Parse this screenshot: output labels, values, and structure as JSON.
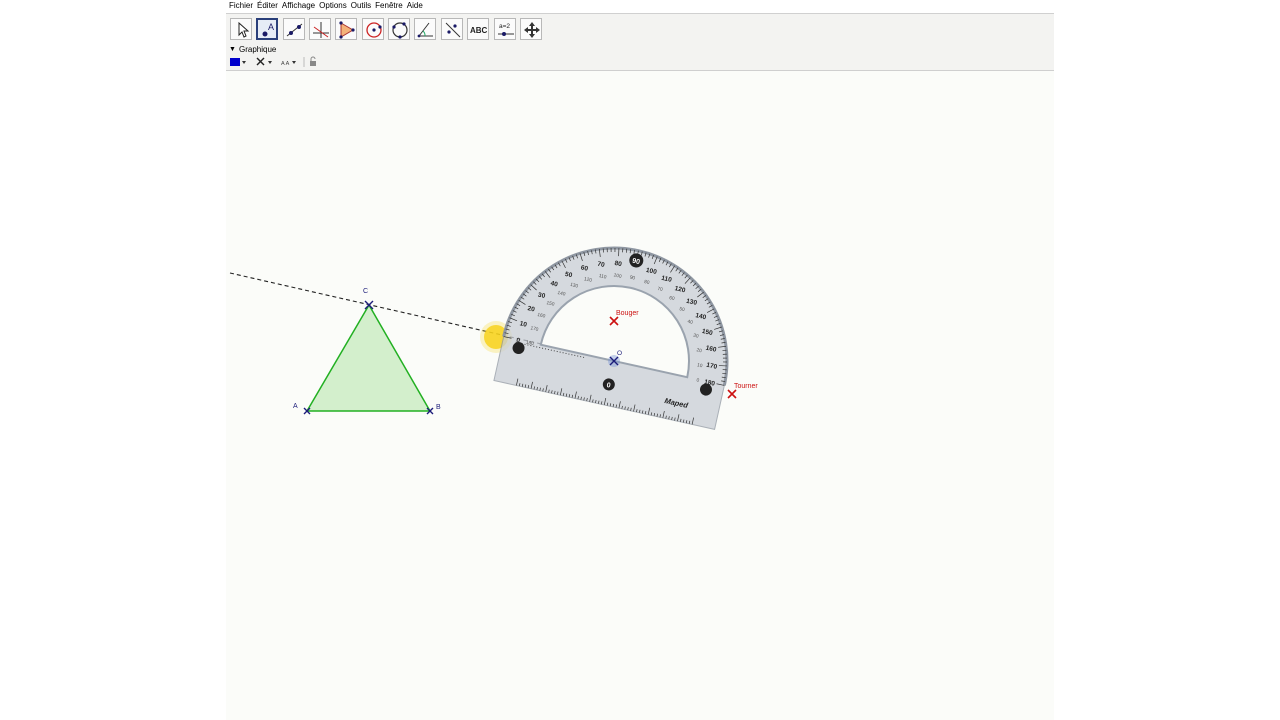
{
  "menu": [
    "Fichier",
    "Éditer",
    "Affichage",
    "Options",
    "Outils",
    "Fenêtre",
    "Aide"
  ],
  "toolbar": {
    "tools": [
      "move-tool",
      "point-tool",
      "line-tool",
      "perpendicular-tool",
      "polygon-tool",
      "circle-center-tool",
      "circle-three-points-tool",
      "angle-tool",
      "reflect-tool",
      "text-tool",
      "slider-tool",
      "move-graphics-tool"
    ],
    "selected_index": 1,
    "text_tool_label": "ABC",
    "slider_tool_label": "a=2"
  },
  "panel": {
    "title": "Graphique"
  },
  "styling": {
    "color": "#0000cc",
    "text_size_label": "A A"
  },
  "geometry": {
    "points": {
      "A": "A",
      "B": "B",
      "C": "C",
      "O": "O"
    },
    "triangle_fill": "#cfeec8",
    "triangle_stroke": "#1fb01f",
    "point_color": "#1c1c7a",
    "red_color": "#cc1111"
  },
  "protractor": {
    "outer_labels": [
      "0",
      "10",
      "20",
      "30",
      "40",
      "50",
      "60",
      "70",
      "80",
      "90",
      "100",
      "110",
      "120",
      "130",
      "140",
      "150",
      "160",
      "170",
      "180"
    ],
    "inner_labels": [
      "180",
      "170",
      "160",
      "150",
      "140",
      "130",
      "120",
      "110",
      "100",
      "90",
      "80",
      "70",
      "60",
      "50",
      "40",
      "30",
      "20",
      "10",
      "0"
    ],
    "ruler_zero": "0",
    "brand": "Maped",
    "bouger_label": "Bouger",
    "tourner_label": "Tourner"
  }
}
